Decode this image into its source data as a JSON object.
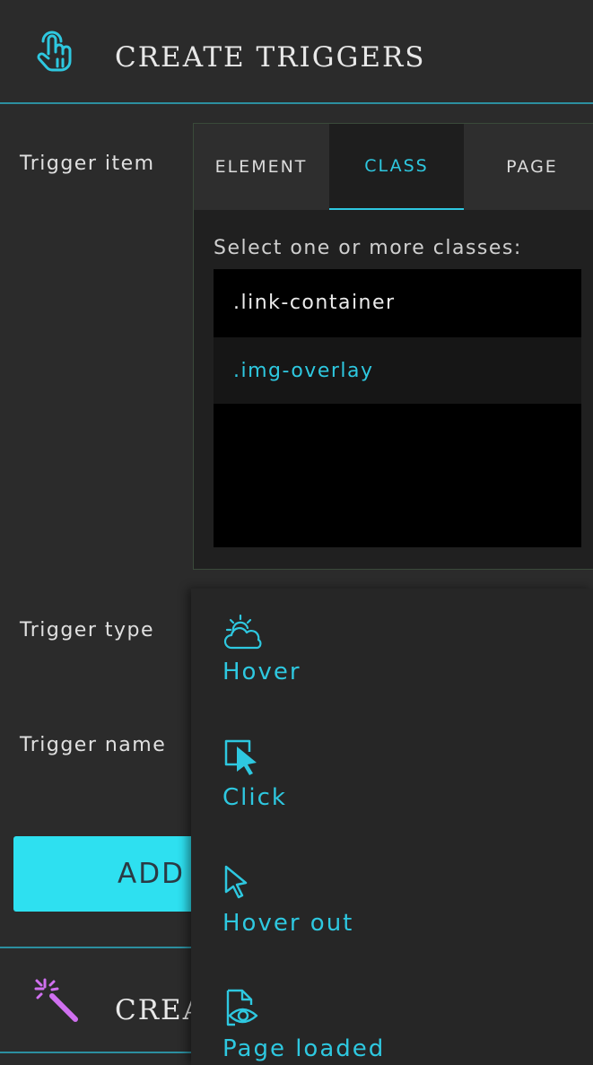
{
  "header": {
    "title": "CREATE TRIGGERS",
    "icon": "hand-pointer-icon"
  },
  "form": {
    "trigger_item_label": "Trigger item",
    "trigger_type_label": "Trigger type",
    "trigger_name_label": "Trigger name"
  },
  "tabs": [
    {
      "label": "ELEMENT",
      "active": false
    },
    {
      "label": "CLASS",
      "active": true
    },
    {
      "label": "PAGE",
      "active": false
    }
  ],
  "class_picker": {
    "hint": "Select one or more classes:",
    "items": [
      {
        "label": ".link-container",
        "selected": false
      },
      {
        "label": ".img-overlay",
        "selected": true
      }
    ]
  },
  "add_button": {
    "label": "ADD"
  },
  "footer_section": {
    "title": "CREA",
    "icon": "magic-wand-icon"
  },
  "trigger_type_options": [
    {
      "label": "Hover",
      "icon": "sun-cloud-icon"
    },
    {
      "label": "Click",
      "icon": "cursor-click-icon"
    },
    {
      "label": "Hover out",
      "icon": "pointer-arrow-icon"
    },
    {
      "label": "Page loaded",
      "icon": "document-eye-icon"
    }
  ],
  "colors": {
    "accent": "#2ec8e0",
    "button": "#2ee0f0",
    "background": "#2b2b2b",
    "wand": "#d070f0"
  }
}
